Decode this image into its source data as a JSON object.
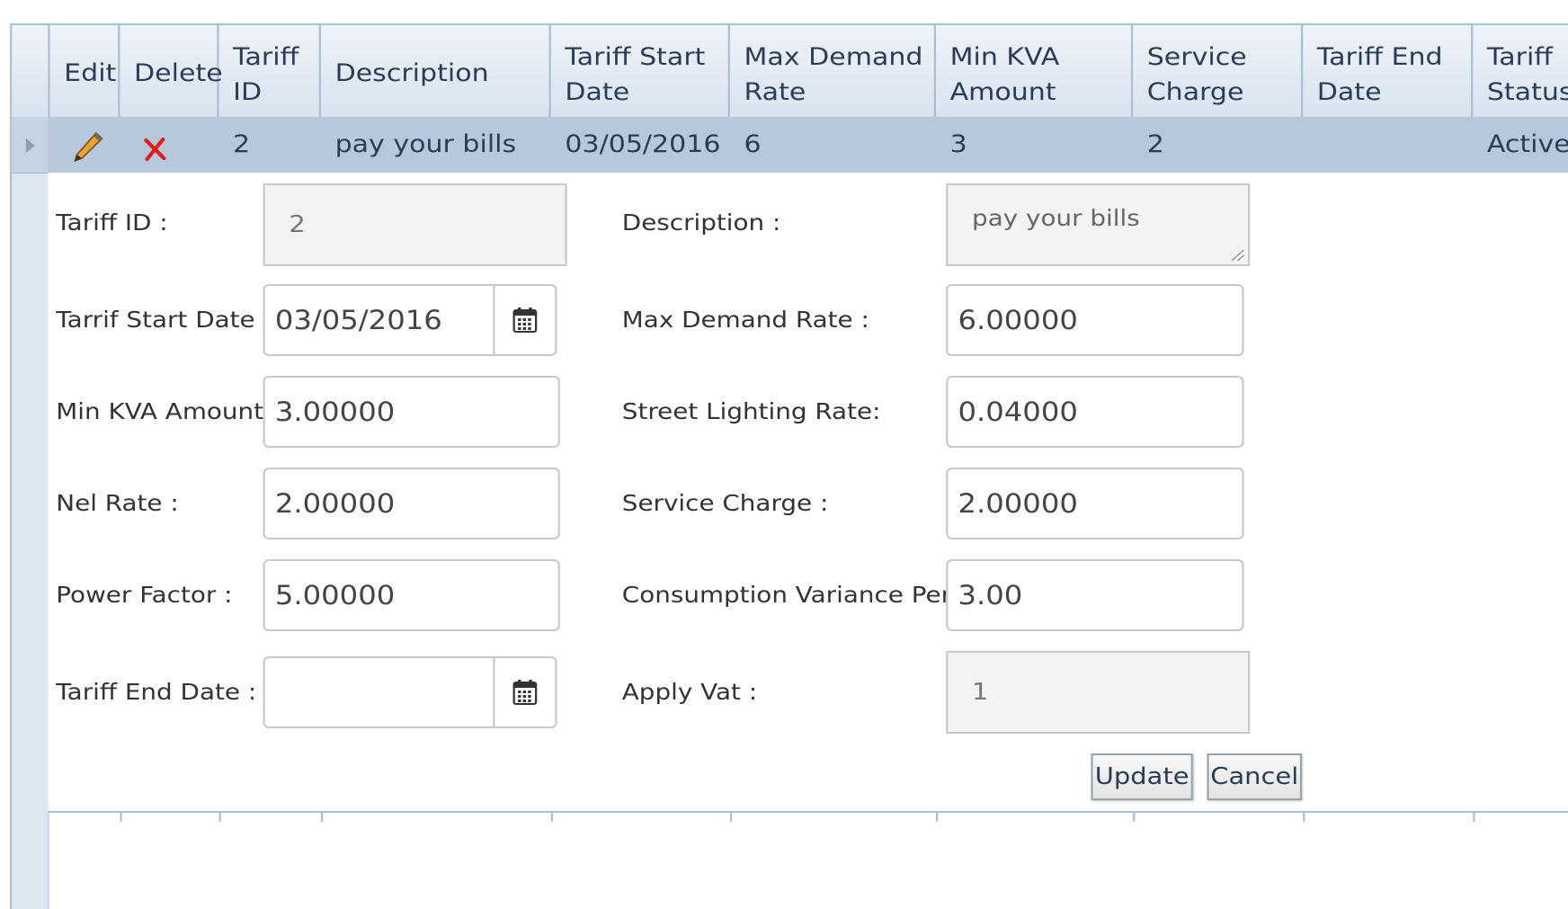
{
  "grid": {
    "columns": [
      {
        "label": "Edit"
      },
      {
        "label": "Delete"
      },
      {
        "label": "Tariff ID"
      },
      {
        "label": "Description"
      },
      {
        "label": "Tariff Start Date"
      },
      {
        "label": "Max Demand Rate"
      },
      {
        "label": "Min KVA Amount"
      },
      {
        "label": "Service Charge"
      },
      {
        "label": "Tariff End Date"
      },
      {
        "label": "Tariff Status"
      }
    ],
    "header_lines": {
      "edit": "Edit",
      "delete": "Delete",
      "tariff_id_1": "Tariff",
      "tariff_id_2": "ID",
      "description": "Description",
      "start_1": "Tariff Start",
      "start_2": "Date",
      "maxdemand_1": "Max Demand",
      "maxdemand_2": "Rate",
      "minkva_1": "Min KVA",
      "minkva_2": "Amount",
      "service_1": "Service",
      "service_2": "Charge",
      "end_1": "Tariff End",
      "end_2": "Date",
      "status_1": "Tariff",
      "status_2": "Status"
    },
    "selected_row": {
      "tariff_id": "2",
      "description": "pay your bills",
      "start_date": "03/05/2016",
      "max_demand_rate": "6",
      "min_kva_amount": "3",
      "service_charge": "2",
      "end_date": "",
      "status": "Active"
    }
  },
  "form": {
    "tariff_id": {
      "label": "Tariff ID :",
      "value": "2"
    },
    "description": {
      "label": "Description :",
      "value": "pay your bills"
    },
    "start_date": {
      "label": "Tarrif Start Date :",
      "value": "03/05/2016"
    },
    "max_demand_rate": {
      "label": "Max Demand Rate :",
      "value": "6.00000"
    },
    "min_kva_amount": {
      "label": "Min KVA Amount",
      "value": "3.00000"
    },
    "street_lighting_rate": {
      "label": "Street Lighting Rate:",
      "value": "0.04000"
    },
    "nel_rate": {
      "label": "Nel Rate :",
      "value": "2.00000"
    },
    "service_charge": {
      "label": "Service Charge :",
      "value": "2.00000"
    },
    "power_factor": {
      "label": "Power Factor :",
      "value": "5.00000"
    },
    "consumption_variance": {
      "label": "Consumption Variance Perc",
      "value": "3.00"
    },
    "end_date": {
      "label": "Tariff End Date :",
      "value": ""
    },
    "apply_vat": {
      "label": "Apply Vat :",
      "value": "1"
    },
    "update_label": "Update",
    "cancel_label": "Cancel"
  },
  "icons": {
    "edit": "pencil-icon",
    "delete": "red-x-icon",
    "calendar": "calendar-icon"
  },
  "colors": {
    "header_bg": "#d7e3ef",
    "selected_row_bg": "#b7c8da",
    "grid_border": "#a9bfd6",
    "delete_red": "#e02020"
  }
}
